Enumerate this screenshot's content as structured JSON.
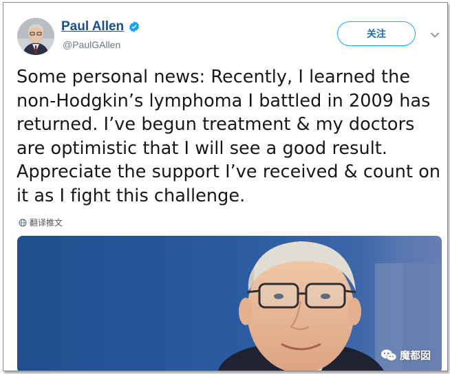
{
  "tweet": {
    "display_name": "Paul Allen",
    "handle": "@PaulGAllen",
    "follow_label": "关注",
    "text": "Some personal news: Recently, I learned the non-Hodgkin’s lymphoma I battled in 2009 has returned. I’ve begun treatment & my doctors are optimistic that I will see a good result. Appreciate the support I’ve received & count on it as I fight this challenge.",
    "translate_label": "翻译推文"
  },
  "watermark": {
    "label": "魔都囡"
  },
  "icons": {
    "verified": "verified-badge-icon",
    "caret": "chevron-down-icon",
    "translate": "globe-icon",
    "watermark": "wechat-icon"
  },
  "colors": {
    "accent": "#1da1f2",
    "name": "#1c4e8f",
    "text": "#14171a",
    "muted": "#657786"
  }
}
